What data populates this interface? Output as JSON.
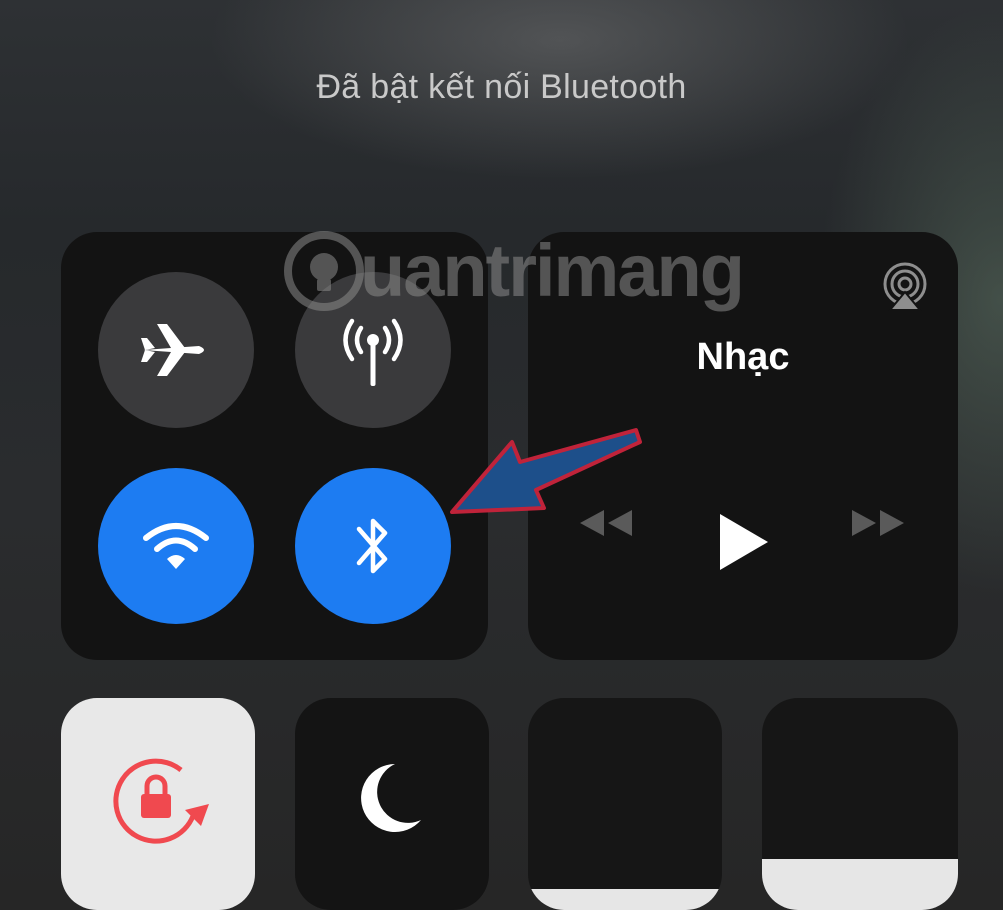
{
  "notification": {
    "text": "Đã bật kết nối Bluetooth"
  },
  "connectivity": {
    "airplane": {
      "icon": "airplane-icon",
      "state": "off"
    },
    "cellular": {
      "icon": "cellular-antenna-icon",
      "state": "off"
    },
    "wifi": {
      "icon": "wifi-icon",
      "state": "on"
    },
    "bluetooth": {
      "icon": "bluetooth-icon",
      "state": "on"
    }
  },
  "music": {
    "title": "Nhạc",
    "airplay_icon": "airplay-icon",
    "controls": [
      "rewind-icon",
      "play-icon",
      "fast-forward-icon"
    ]
  },
  "tiles": {
    "rotation_lock": {
      "icon": "rotation-lock-icon",
      "state": "on"
    },
    "do_not_disturb": {
      "icon": "moon-icon",
      "state": "off"
    },
    "brightness": {
      "level": 0.1
    },
    "volume": {
      "level": 0.24
    }
  },
  "watermark": {
    "text": "uantrimang",
    "icon": "lightbulb-logo-icon"
  },
  "colors": {
    "accent": "#1d7cf2",
    "rotation_red": "#f0494f",
    "annotation_arrow": "#1d4f8a"
  }
}
